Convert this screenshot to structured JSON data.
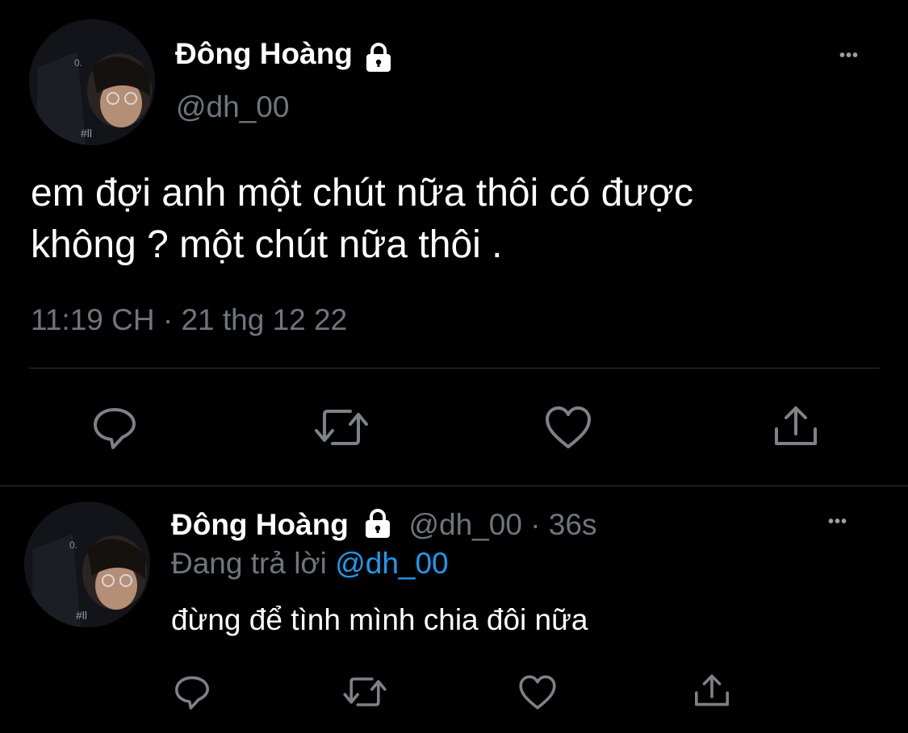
{
  "main_tweet": {
    "display_name": "Đông Hoàng",
    "handle": "@dh_00",
    "text_line1": "em đợi anh một chút nữa thôi có được",
    "text_line2": "không ? một chút nữa thôi .",
    "timestamp": "11:19 CH · 21 thg 12 22",
    "more": "•••"
  },
  "reply_tweet": {
    "display_name": "Đông Hoàng",
    "handle_time": "@dh_00 · 36s",
    "replying_prefix": "Đang trả lời",
    "replying_to": "@dh_00",
    "text": "đừng để tình mình chia đôi nữa",
    "more": "•••"
  },
  "colors": {
    "background": "#000000",
    "text": "#ffffff",
    "muted": "#6e767d",
    "link": "#1d9bf0",
    "divider": "#2f3336"
  },
  "icons": [
    "lock-icon",
    "more-icon",
    "reply-icon",
    "retweet-icon",
    "like-icon",
    "share-icon"
  ]
}
